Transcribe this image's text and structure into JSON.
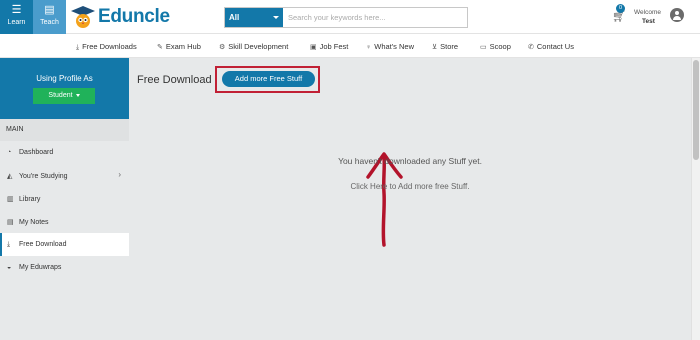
{
  "header": {
    "learn_label": "Learn",
    "teach_label": "Teach",
    "logo_text": "Eduncle",
    "search": {
      "category": "All",
      "placeholder": "Search your keywords here..."
    },
    "cart_count": "0",
    "welcome_label": "Welcome",
    "user_name": "Test"
  },
  "nav": {
    "items": [
      {
        "icon": "download-icon",
        "label": "Free Downloads"
      },
      {
        "icon": "edit-icon",
        "label": "Exam Hub"
      },
      {
        "icon": "gear-icon",
        "label": "Skill Development"
      },
      {
        "icon": "briefcase-icon",
        "label": "Job Fest"
      },
      {
        "icon": "bulb-icon",
        "label": "What's New"
      },
      {
        "icon": "cart-icon",
        "label": "Store"
      },
      {
        "icon": "video-icon",
        "label": "Scoop"
      },
      {
        "icon": "phone-icon",
        "label": "Contact Us"
      }
    ]
  },
  "sidebar": {
    "profile_label": "Using Profile As",
    "role": "Student",
    "section": "MAIN",
    "items": [
      {
        "icon": "dashboard-icon",
        "label": "Dashboard"
      },
      {
        "icon": "graduation-cap-icon",
        "label": "You're Studying"
      },
      {
        "icon": "library-icon",
        "label": "Library"
      },
      {
        "icon": "note-icon",
        "label": "My Notes"
      },
      {
        "icon": "download-icon",
        "label": "Free Download"
      },
      {
        "icon": "cap-icon",
        "label": "My Eduwraps"
      }
    ]
  },
  "main": {
    "title": "Free Download",
    "add_button": "Add more Free Stuff",
    "empty_message": "You haven't downloaded any Stuff yet.",
    "empty_link": "Click Here to Add more free Stuff."
  },
  "colors": {
    "brand": "#1378a9",
    "role_badge": "#20b25a",
    "annotation": "#c12035"
  }
}
